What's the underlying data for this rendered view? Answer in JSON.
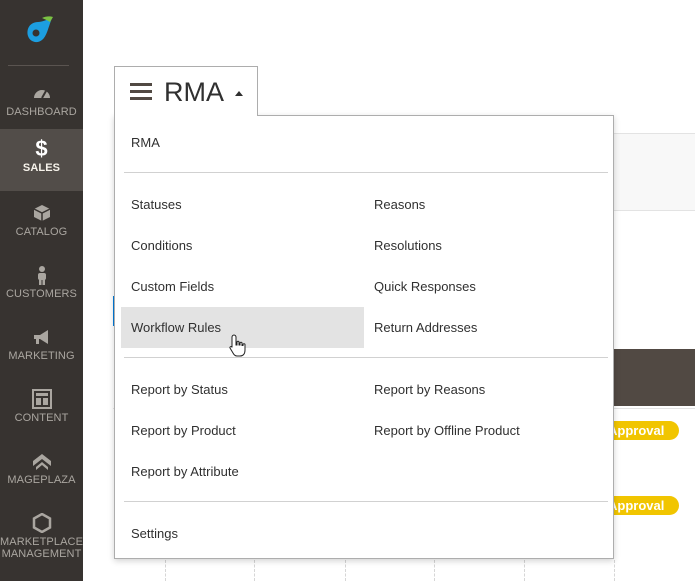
{
  "sidebar": {
    "items": [
      {
        "label": "DASHBOARD",
        "icon": "dashboard-icon"
      },
      {
        "label": "SALES",
        "icon": "dollar-icon",
        "active": true
      },
      {
        "label": "CATALOG",
        "icon": "cube-icon"
      },
      {
        "label": "CUSTOMERS",
        "icon": "person-icon"
      },
      {
        "label": "MARKETING",
        "icon": "megaphone-icon"
      },
      {
        "label": "CONTENT",
        "icon": "layout-icon"
      },
      {
        "label": "MAGEPLAZA",
        "icon": "mageplaza-icon"
      },
      {
        "label": "MARKETPLACE\nMANAGEMENT",
        "label_line1": "MARKETPLACE",
        "label_line2": "MANAGEMENT",
        "icon": "hexagon-icon"
      }
    ]
  },
  "menu": {
    "title": "RMA",
    "items": {
      "rma": "RMA",
      "statuses": "Statuses",
      "reasons": "Reasons",
      "conditions": "Conditions",
      "resolutions": "Resolutions",
      "custom_fields": "Custom Fields",
      "quick_responses": "Quick Responses",
      "workflow_rules": "Workflow Rules",
      "return_addresses": "Return Addresses",
      "report_by_status": "Report by Status",
      "report_by_reasons": "Report by Reasons",
      "report_by_product": "Report by Product",
      "report_by_offline_product": "Report by Offline Product",
      "report_by_attribute": "Report by Attribute",
      "settings": "Settings"
    },
    "hovered": "workflow_rules"
  },
  "grid": {
    "badges": [
      "Approval",
      "Approval"
    ]
  },
  "colors": {
    "sidebar_bg": "#373330",
    "sidebar_active": "#524d49",
    "badge": "#f1c500",
    "grid_header": "#514943",
    "accent_blue": "#007bdb"
  }
}
